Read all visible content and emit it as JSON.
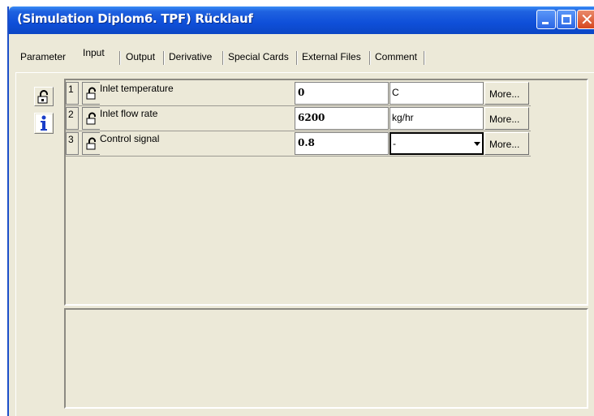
{
  "window": {
    "title": "(Simulation Diplom6. TPF) Rücklauf",
    "controls": {
      "minimize": "minimize-icon",
      "maximize": "maximize-icon",
      "close": "close-icon"
    },
    "accent": "#0f4fd9"
  },
  "tabs": [
    {
      "label": "Parameter",
      "active": false
    },
    {
      "label": "Input",
      "active": true
    },
    {
      "label": "Output",
      "active": false
    },
    {
      "label": "Derivative",
      "active": false
    },
    {
      "label": "Special Cards",
      "active": false
    },
    {
      "label": "External Files",
      "active": false
    },
    {
      "label": "Comment",
      "active": false
    }
  ],
  "side_buttons": [
    {
      "icon": "unlock-icon"
    },
    {
      "icon": "info-icon"
    }
  ],
  "inputs": [
    {
      "index": "1",
      "name": "Inlet temperature",
      "value": "0",
      "unit": "C",
      "more": "More...",
      "unit_dropdown": false
    },
    {
      "index": "2",
      "name": "Inlet flow rate",
      "value": "6200",
      "unit": "kg/hr",
      "more": "More...",
      "unit_dropdown": false
    },
    {
      "index": "3",
      "name": "Control signal",
      "value": "0.8",
      "unit": "-",
      "more": "More...",
      "unit_dropdown": true
    }
  ]
}
